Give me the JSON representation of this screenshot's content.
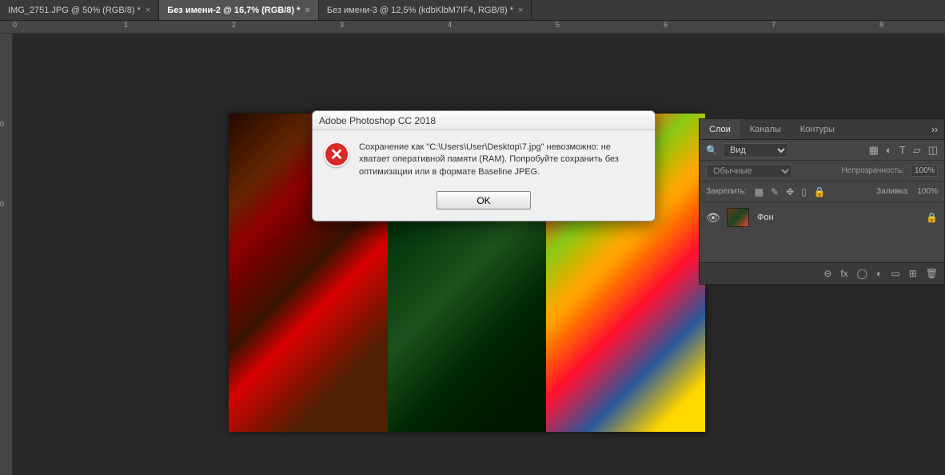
{
  "tabs": [
    {
      "label": "IMG_2751.JPG @ 50% (RGB/8) *",
      "active": false
    },
    {
      "label": "Без имени-2 @ 16,7% (RGB/8) *",
      "active": true
    },
    {
      "label": "Без имени-3 @ 12,5% (kdbKlbM7IF4, RGB/8) *",
      "active": false
    }
  ],
  "ruler": {
    "top_marks": [
      "0",
      "1",
      "2",
      "3",
      "4",
      "5",
      "6",
      "7",
      "8"
    ],
    "left_marks": [
      "0",
      "0"
    ]
  },
  "dialog": {
    "title": "Adobe Photoshop CC 2018",
    "message": "Сохранение как \"C:\\Users\\User\\Desktop\\7.jpg\" невозможно: не хватает оперативной памяти (RAM). Попробуйте сохранить без оптимизации или в формате Baseline JPEG.",
    "ok_label": "OK"
  },
  "layers_panel": {
    "tabs": {
      "layers": "Слои",
      "channels": "Каналы",
      "paths": "Контуры"
    },
    "filter": {
      "kind_label": "Вид"
    },
    "blend": {
      "normal": "Обычные",
      "opacity_label": "Непрозрачность:",
      "opacity_value": "100%"
    },
    "lock": {
      "label": "Закрепить:",
      "fill_label": "Заливка:",
      "fill_value": "100%"
    },
    "layer": {
      "name": "Фон"
    },
    "footer_icons": {
      "link": "⊖",
      "fx": "fx",
      "mask": "◯",
      "adjust": "◐",
      "group": "▭",
      "new": "⊞",
      "trash": "🗑"
    }
  }
}
